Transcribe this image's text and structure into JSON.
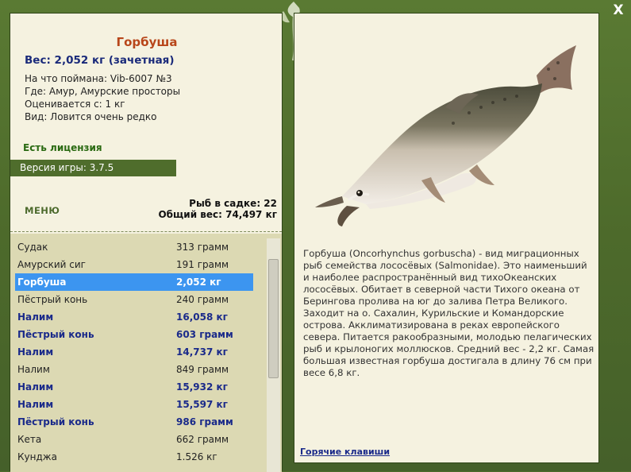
{
  "window": {
    "close_label": "X"
  },
  "fish": {
    "title": "Горбуша",
    "weight_line": "Вес: 2,052 кг (зачетная)",
    "caught_with": "На что поймана: Vib-6007 №3",
    "location": "Где: Амур, Амурские просторы",
    "rated_from": "Оценивается с: 1 кг",
    "kind": "Вид: Ловится очень редко"
  },
  "license_text": "Есть лицензия",
  "version_text": "Версия игры: 3.7.5",
  "menu_label": "МЕНЮ",
  "keepnet": {
    "count_text": "Рыб в садке: 22",
    "total_weight_text": "Общий вес: 74,497 кг"
  },
  "catch_list": [
    {
      "name": "Судак",
      "weight": "313 грамм",
      "style": "normal"
    },
    {
      "name": "Амурский сиг",
      "weight": "191 грамм",
      "style": "normal"
    },
    {
      "name": "Горбуша",
      "weight": "2,052 кг",
      "style": "selected"
    },
    {
      "name": "Пёстрый конь",
      "weight": "240 грамм",
      "style": "normal"
    },
    {
      "name": "Налим",
      "weight": "16,058 кг",
      "style": "trophy"
    },
    {
      "name": "Пёстрый конь",
      "weight": "603 грамм",
      "style": "trophy"
    },
    {
      "name": "Налим",
      "weight": "14,737 кг",
      "style": "trophy"
    },
    {
      "name": "Налим",
      "weight": "849 грамм",
      "style": "normal"
    },
    {
      "name": "Налим",
      "weight": "15,932 кг",
      "style": "trophy"
    },
    {
      "name": "Налим",
      "weight": "15,597 кг",
      "style": "trophy"
    },
    {
      "name": "Пёстрый конь",
      "weight": "986 грамм",
      "style": "trophy"
    },
    {
      "name": "Кета",
      "weight": "662 грамм",
      "style": "normal"
    },
    {
      "name": "Кунджа",
      "weight": "1.526 кг",
      "style": "normal"
    }
  ],
  "description": "Горбуша (Oncorhynchus gorbuscha) - вид миграционных рыб семейства лососёвых (Salmonidae). Это наименьший и наиболее распространённый вид тихоОкеанских лососёвых. Обитает в северной части Тихого океана от Берингова пролива на юг до залива Петра Великого. Заходит на о. Сахалин, Курильские и Командорские острова. Акклиматизирована в реках европейского севера. Питается ракообразными, молодью пелагических рыб и крылоногих моллюсков. Средний вес - 2,2 кг. Самая большая известная горбуша достигала в длину 76 см при весе 6,8 кг.",
  "hotkeys_label": "Горячие клавиши",
  "colors": {
    "frame": "#4e6b2c",
    "panel": "#f5f2e0",
    "title": "#b8461a",
    "trophy_text": "#1a2a8a",
    "selected_row": "#3c95f0",
    "license": "#2a6a12"
  }
}
